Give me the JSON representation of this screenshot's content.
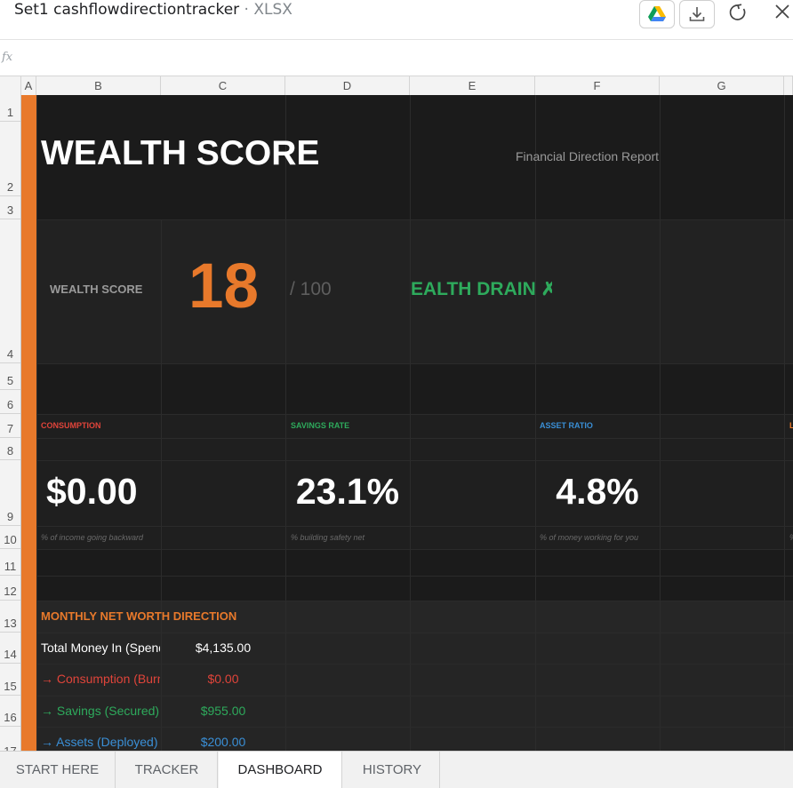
{
  "window": {
    "file_name": "Set1 cashflowdirectiontracker",
    "file_ext": " · XLSX"
  },
  "toolbar": {
    "icons": [
      "google-drive-icon",
      "download-icon",
      "refresh-icon",
      "close-icon"
    ]
  },
  "formula_bar": {
    "fx_label": "fx",
    "value": ""
  },
  "columns": [
    "A",
    "B",
    "C",
    "D",
    "E",
    "F",
    "G"
  ],
  "rows": [
    "1",
    "2",
    "3",
    "4",
    "5",
    "6",
    "7",
    "8",
    "9",
    "10",
    "11",
    "12",
    "13",
    "14",
    "15",
    "16",
    "17"
  ],
  "header": {
    "title": "WEALTH SCORE",
    "subtitle": "Financial Direction Report"
  },
  "score": {
    "label": "WEALTH SCORE",
    "value": "18",
    "max": "/ 100",
    "status": "EALTH DRAIN ✗"
  },
  "kpis": [
    {
      "label": "CONSUMPTION",
      "value": "$0.00",
      "caption": "% of income going backward",
      "color": "#e0443a"
    },
    {
      "label": "SAVINGS RATE",
      "value": "23.1%",
      "caption": "% building safety net",
      "color": "#2eaa5c"
    },
    {
      "label": "ASSET RATIO",
      "value": "4.8%",
      "caption": "% of money working for you",
      "color": "#3a8fd6"
    },
    {
      "label": "L",
      "caption": "%"
    }
  ],
  "monthly": {
    "title": "MONTHLY NET WORTH DIRECTION",
    "rows": [
      {
        "label": "Total Money In (Spend",
        "value": "$4,135.00",
        "color": "#ffffff"
      },
      {
        "label": "→ Consumption (Burn",
        "value": "$0.00",
        "color": "#e0443a"
      },
      {
        "label": "→ Savings (Secured)",
        "value": "$955.00",
        "color": "#2eaa5c"
      },
      {
        "label": "→ Assets (Deployed)",
        "value": "$200.00",
        "color": "#3a8fd6"
      }
    ]
  },
  "tabs": [
    "START HERE",
    "TRACKER",
    "DASHBOARD",
    "HISTORY"
  ],
  "active_tab": "DASHBOARD",
  "colors": {
    "accent": "#e8792b",
    "background": "#1b1b1b"
  }
}
